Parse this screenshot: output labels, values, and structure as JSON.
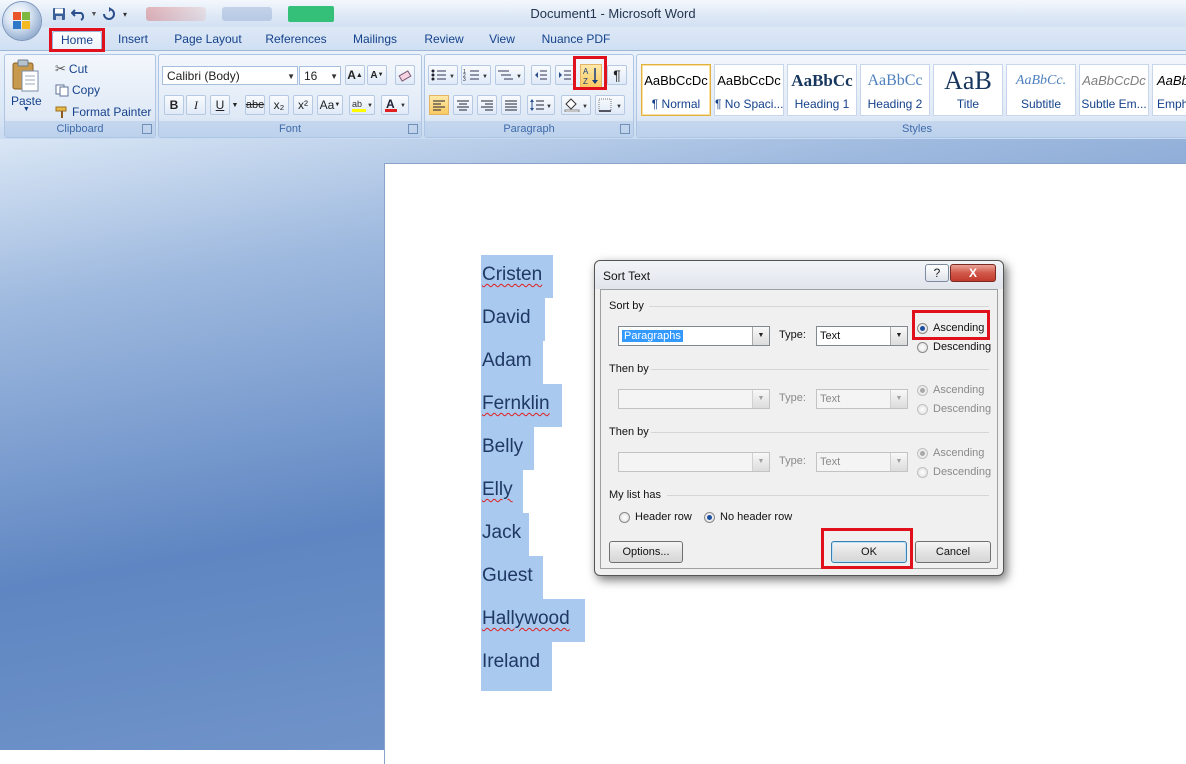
{
  "window": {
    "title": "Document1 - Microsoft Word"
  },
  "tabs": [
    "Home",
    "Insert",
    "Page Layout",
    "References",
    "Mailings",
    "Review",
    "View",
    "Nuance PDF"
  ],
  "clipboard": {
    "group_label": "Clipboard",
    "paste_label": "Paste",
    "cut_label": "Cut",
    "copy_label": "Copy",
    "format_painter_label": "Format Painter"
  },
  "font": {
    "group_label": "Font",
    "font_name": "Calibri (Body)",
    "font_size": "16",
    "bold": "B",
    "italic": "I",
    "underline": "U",
    "strikethrough": "abe",
    "subscript": "x₂",
    "superscript": "x²",
    "change_case": "Aa",
    "grow_font": "A",
    "shrink_font": "A"
  },
  "paragraph": {
    "group_label": "Paragraph"
  },
  "styles": {
    "group_label": "Styles",
    "items": [
      {
        "preview": "AaBbCcDc",
        "name": "¶ Normal"
      },
      {
        "preview": "AaBbCcDc",
        "name": "¶ No Spaci..."
      },
      {
        "preview": "AaBbCc",
        "name": "Heading 1"
      },
      {
        "preview": "AaBbCc",
        "name": "Heading 2"
      },
      {
        "preview": "AaB",
        "name": "Title"
      },
      {
        "preview": "AaBbCc.",
        "name": "Subtitle"
      },
      {
        "preview": "AaBbCcDc",
        "name": "Subtle Em..."
      },
      {
        "preview": "AaBbCc",
        "name": "Emph"
      }
    ]
  },
  "document": {
    "names": [
      "Cristen",
      "David",
      "Adam",
      "Fernklin",
      "Belly",
      "Elly",
      "Jack",
      "Guest",
      "Hallywood",
      "Ireland"
    ]
  },
  "dialog": {
    "title": "Sort Text",
    "help": "?",
    "close": "X",
    "sort_by_label": "Sort by",
    "sort_by_value": "Paragraphs",
    "type_label": "Type:",
    "type_value": "Text",
    "ascending_label": "Ascending",
    "descending_label": "Descending",
    "then_by_1_label": "Then by",
    "then_by_2_label": "Then by",
    "my_list_has_label": "My list has",
    "header_row_label": "Header row",
    "no_header_row_label": "No header row",
    "options_button": "Options...",
    "ok_button": "OK",
    "cancel_button": "Cancel"
  },
  "colors": {
    "highlight": "#e0101c",
    "selection": "#a9c9ee"
  }
}
